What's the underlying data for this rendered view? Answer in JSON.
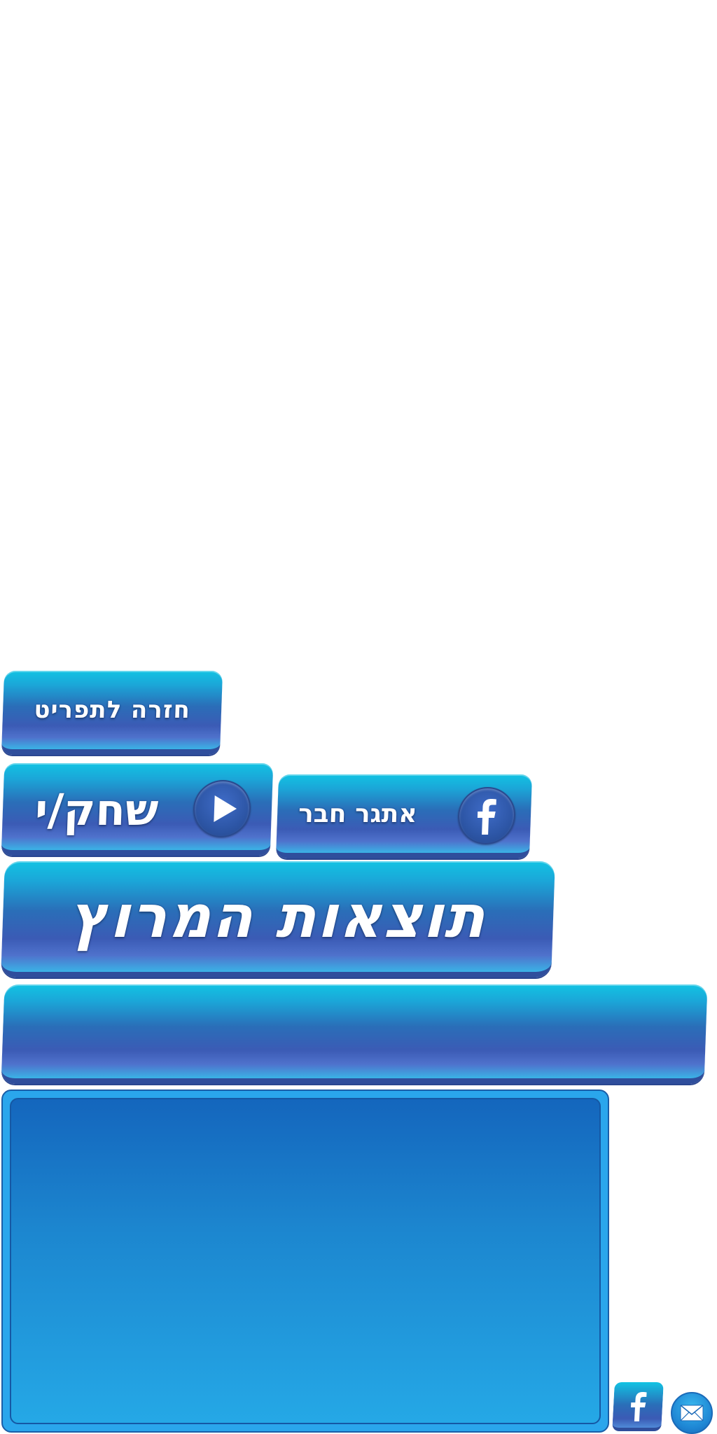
{
  "back_button": {
    "label": "חזרה לתפריט",
    "icon": "none"
  },
  "play_button": {
    "label": "שחק/י",
    "icon": "play-icon"
  },
  "facebook_challenge_button": {
    "label": "אתגר חבר",
    "icon": "facebook-icon"
  },
  "title_banner": {
    "label": "תוצאות המרוץ"
  },
  "empty_banner": {
    "label": ""
  },
  "results_panel": {
    "content": ""
  },
  "footer": {
    "facebook_icon": "facebook-icon",
    "mail_icon": "mail-icon"
  },
  "colors": {
    "button_top": "#12c3e3",
    "button_mid": "#2a6eb8",
    "button_bottom": "#3b5bb5",
    "panel": "#1c86cf",
    "panel_border": "#2aa6ec"
  }
}
